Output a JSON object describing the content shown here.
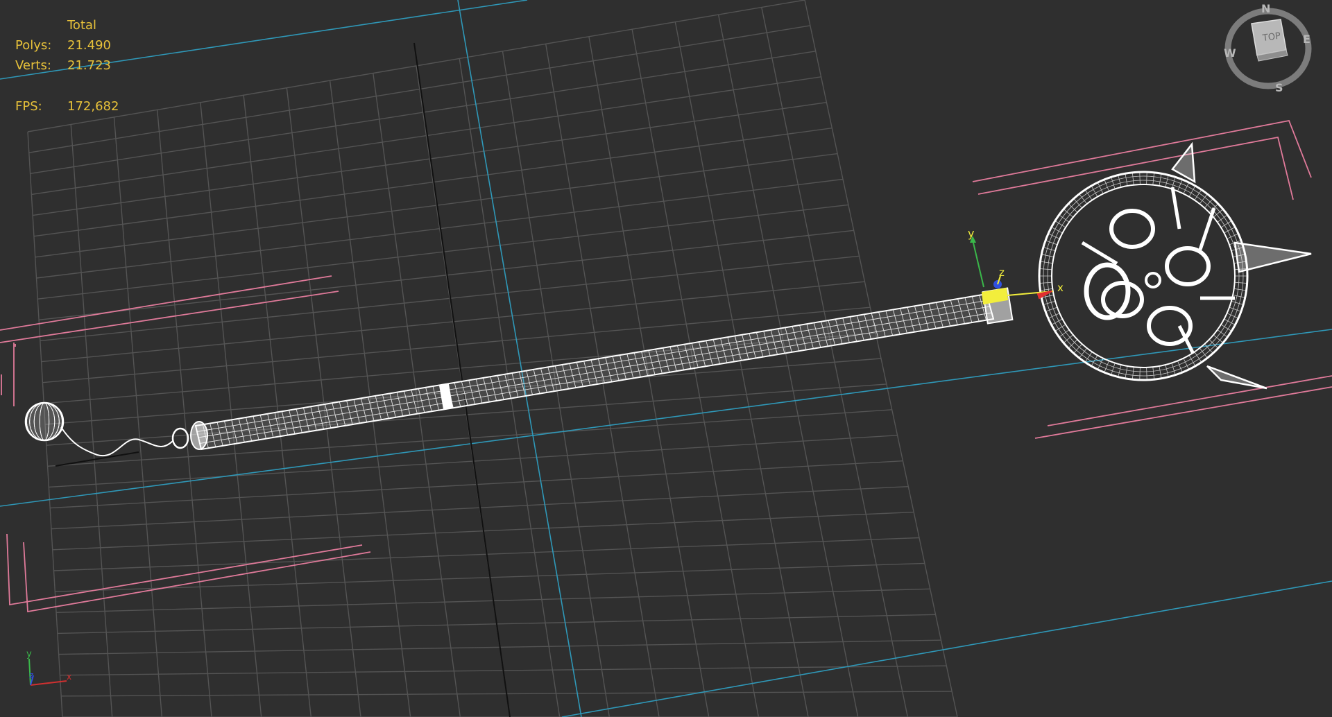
{
  "viewport": {
    "label": "Top",
    "background_color": "#2f2f2f",
    "grid_color": "#545454",
    "home_grid_axis_color": "#2f98b8",
    "selection_bracket_color": "#e07a9a",
    "wireframe_color": "#ffffff"
  },
  "stats": {
    "header": "Total",
    "polys_label": "Polys:",
    "polys_value": "21.490",
    "verts_label": "Verts:",
    "verts_value": "21.723",
    "fps_label": "FPS:",
    "fps_value": "172,682"
  },
  "viewcube": {
    "face_label": "TOP",
    "compass": {
      "north": "N",
      "east": "E",
      "south": "S",
      "west": "W"
    }
  },
  "gizmo": {
    "x_label": "x",
    "y_label": "y",
    "z_label": "z",
    "x_color": "#e03030",
    "y_color": "#3ab84a",
    "z_color": "#3050e0",
    "active_color": "#f2ee3c"
  },
  "axis_tripod": {
    "x_label": "x",
    "y_label": "y",
    "z_label": "z"
  },
  "object": {
    "icon": "keyblade-wireframe-icon"
  }
}
